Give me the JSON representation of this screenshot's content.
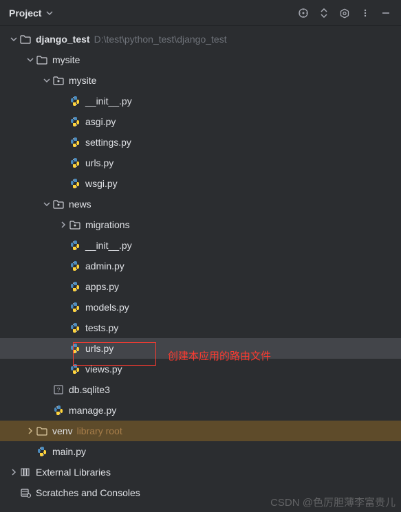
{
  "toolbar": {
    "title": "Project"
  },
  "tree": {
    "root": {
      "name": "django_test",
      "path": "D:\\test\\python_test\\django_test",
      "mysite_dir": "mysite",
      "mysite_pkg": "mysite",
      "mysite_files": [
        "__init__.py",
        "asgi.py",
        "settings.py",
        "urls.py",
        "wsgi.py"
      ],
      "news_dir": "news",
      "migrations": "migrations",
      "news_files": [
        "__init__.py",
        "admin.py",
        "apps.py",
        "models.py",
        "tests.py",
        "urls.py",
        "views.py"
      ],
      "db_file": "db.sqlite3",
      "manage": "manage.py",
      "venv": "venv",
      "venv_label": "library root",
      "main": "main.py"
    },
    "ext_lib": "External Libraries",
    "scratches": "Scratches and Consoles"
  },
  "annotation": {
    "text": "创建本应用的路由文件"
  },
  "watermark": "CSDN @色厉胆薄李富贵儿"
}
